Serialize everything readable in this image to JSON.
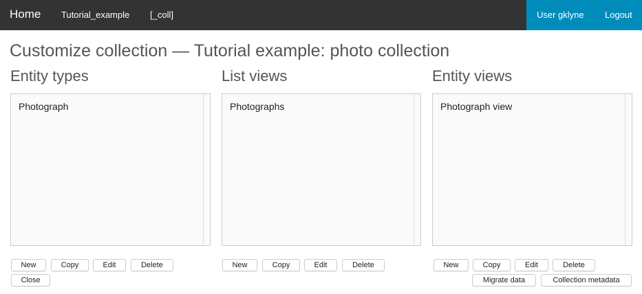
{
  "nav": {
    "home": "Home",
    "collection": "Tutorial_example",
    "type": "[_coll]",
    "user": "User gklyne",
    "logout": "Logout"
  },
  "page": {
    "title": "Customize collection — Tutorial example: photo collection"
  },
  "columns": [
    {
      "heading": "Entity types",
      "items": [
        "Photograph"
      ],
      "buttons": [
        "New",
        "Copy",
        "Edit",
        "Delete",
        "Close"
      ]
    },
    {
      "heading": "List views",
      "items": [
        "Photographs"
      ],
      "buttons": [
        "New",
        "Copy",
        "Edit",
        "Delete"
      ]
    },
    {
      "heading": "Entity views",
      "items": [
        "Photograph view"
      ],
      "buttons": [
        "New",
        "Copy",
        "Edit",
        "Delete",
        "Migrate data",
        "Collection metadata"
      ]
    }
  ],
  "colors": {
    "topbar": "#333333",
    "user_panel": "#008cba",
    "heading_text": "#555555"
  }
}
